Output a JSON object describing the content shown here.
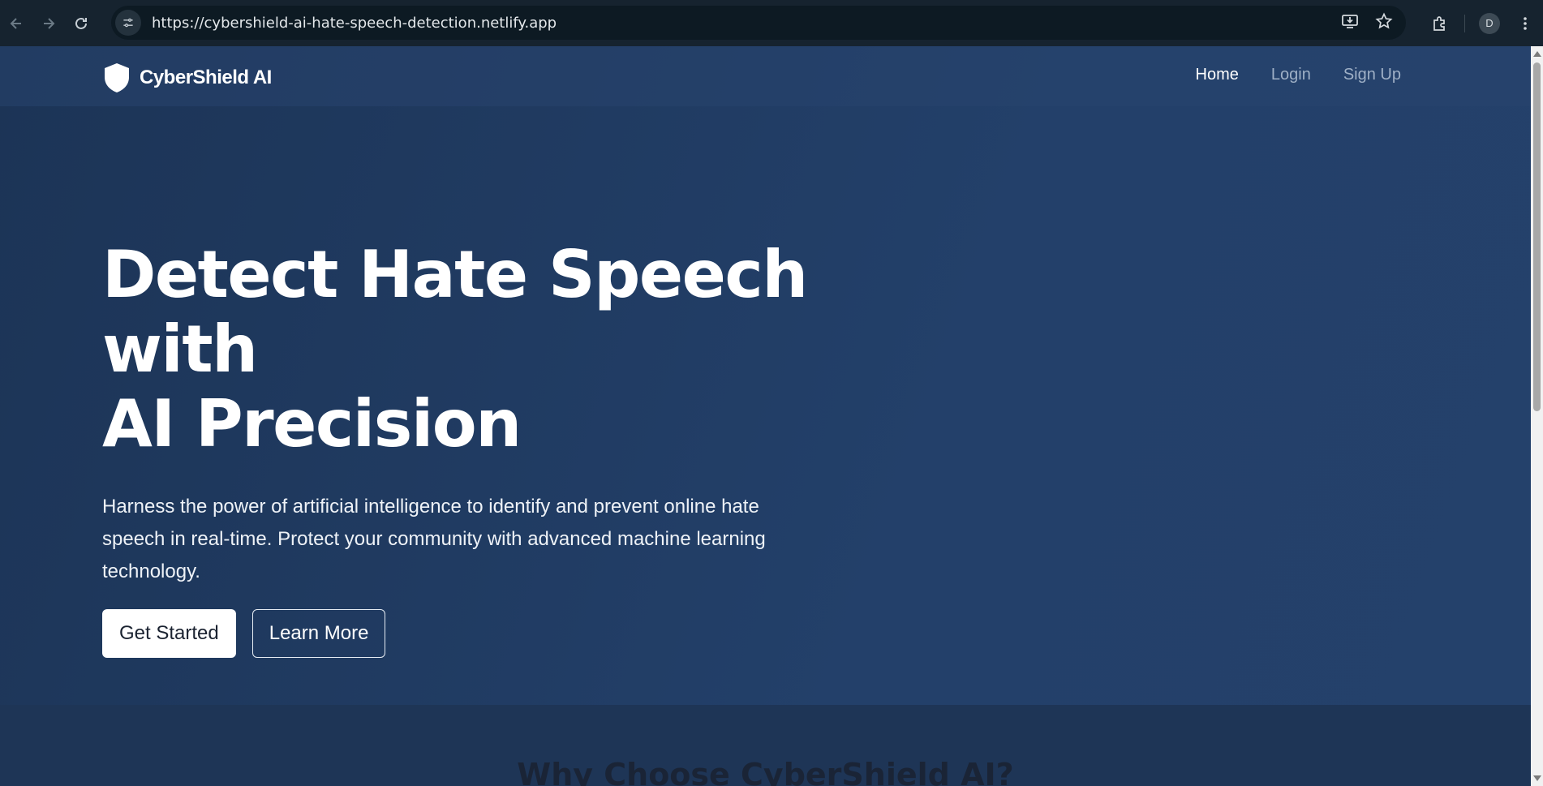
{
  "browser": {
    "url": "https://cybershield-ai-hate-speech-detection.netlify.app",
    "profile_initial": "D"
  },
  "site": {
    "brand": "CyberShield AI",
    "nav": [
      {
        "label": "Home",
        "current": true
      },
      {
        "label": "Login",
        "current": false
      },
      {
        "label": "Sign Up",
        "current": false
      }
    ]
  },
  "hero": {
    "title_line1": "Detect Hate Speech with",
    "title_line2": "AI Precision",
    "description": "Harness the power of artificial intelligence to identify and prevent online hate speech in real-time. Protect your community with advanced machine learning technology.",
    "primary_button": "Get Started",
    "secondary_button": "Learn More"
  },
  "features": {
    "heading": "Why Choose CyberShield AI?"
  },
  "colors": {
    "background": "#1f3a5f",
    "accent": "#ffffff"
  }
}
